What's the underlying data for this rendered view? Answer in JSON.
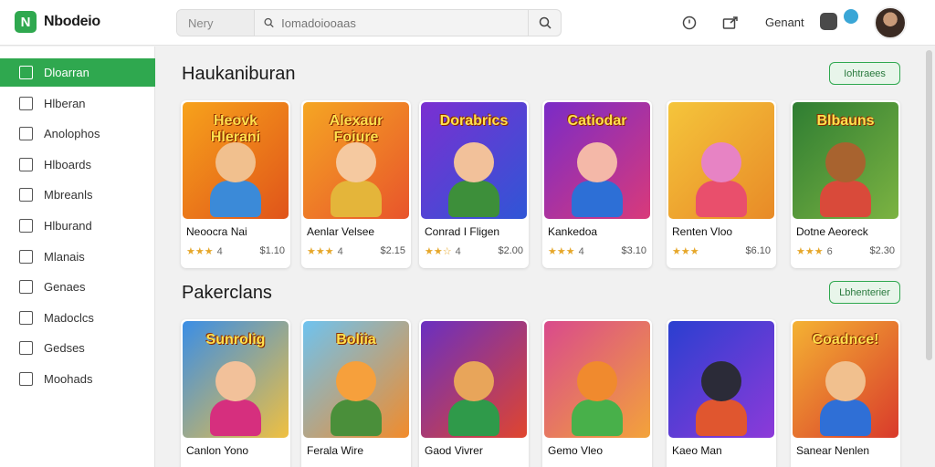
{
  "app": {
    "logo_letter": "N",
    "name": "Nbodeio"
  },
  "search": {
    "scope": "Nery",
    "placeholder": "Iomadoiooaas"
  },
  "topbar": {
    "label": "Genant"
  },
  "sidebar": {
    "items": [
      {
        "label": "Dloarran",
        "active": true
      },
      {
        "label": "Hlberan"
      },
      {
        "label": "Anolophos"
      },
      {
        "label": "Hlboards"
      },
      {
        "label": "Mbreanls"
      },
      {
        "label": "Hlburand"
      },
      {
        "label": "Mlanais"
      },
      {
        "label": "Genaes"
      },
      {
        "label": "Madoclcs"
      },
      {
        "label": "Gedses"
      },
      {
        "label": "Moohads"
      }
    ]
  },
  "sections": [
    {
      "title": "Haukaniburan",
      "action": "Iohtraees",
      "cards": [
        {
          "art_title": "Heovk Hlerani",
          "title": "Neoocra Nai",
          "stars": "★★★",
          "rating": "4",
          "price": "$1.10",
          "colors": [
            "#f7a21b",
            "#e0541a"
          ],
          "head": "#f1c08e",
          "body": "#3b8ad8"
        },
        {
          "art_title": "Alexaur Foiure",
          "title": "Aenlar Velsee",
          "stars": "★★★",
          "rating": "4",
          "price": "$2.15",
          "colors": [
            "#f5a623",
            "#e8542b"
          ],
          "head": "#f5c9a0",
          "body": "#e4b53a"
        },
        {
          "art_title": "Dorabrics",
          "title": "Conrad I Fligen",
          "stars": "★★☆",
          "rating": "4",
          "price": "$2.00",
          "colors": [
            "#7b2fd1",
            "#2f56d6"
          ],
          "head": "#f2c19a",
          "body": "#3d8f3a"
        },
        {
          "art_title": "Catiodar",
          "title": "Kankedoa",
          "stars": "★★★",
          "rating": "4",
          "price": "$3.10",
          "colors": [
            "#7a2bc7",
            "#d93a7a"
          ],
          "head": "#f4b8a8",
          "body": "#2d6fd6"
        },
        {
          "art_title": "",
          "title": "Renten Vloo",
          "stars": "★★★",
          "rating": "",
          "price": "$6.10",
          "colors": [
            "#f5c53b",
            "#e88a27"
          ],
          "head": "#e783c4",
          "body": "#e94f6c"
        },
        {
          "art_title": "Blbauns",
          "title": "Dotne Aeoreck",
          "stars": "★★★",
          "rating": "6",
          "price": "$2.30",
          "colors": [
            "#2e7d32",
            "#7cb342"
          ],
          "head": "#a8632f",
          "body": "#d94a3a"
        }
      ]
    },
    {
      "title": "Pakerclans",
      "action": "Lbhenterier",
      "cards": [
        {
          "art_title": "Sunrolig",
          "title": "Canlon Yono",
          "colors": [
            "#3a8ee6",
            "#f0c040"
          ],
          "head": "#f2c19a",
          "body": "#d62f7e"
        },
        {
          "art_title": "Boliia",
          "title": "Ferala Wire",
          "colors": [
            "#6ec3f0",
            "#f28b2a"
          ],
          "head": "#f6a03c",
          "body": "#4a8f3a"
        },
        {
          "art_title": "",
          "title": "Gaod Vivrer",
          "colors": [
            "#6a2fc1",
            "#e0452e"
          ],
          "head": "#e8a55a",
          "body": "#2f9a4a"
        },
        {
          "art_title": "",
          "title": "Gemo Vleo",
          "colors": [
            "#d94a8c",
            "#f3a33a"
          ],
          "head": "#f08a2e",
          "body": "#48b04a"
        },
        {
          "art_title": "",
          "title": "Kaeo Man",
          "colors": [
            "#2a3fd0",
            "#8d3ad9"
          ],
          "head": "#2b2b38",
          "body": "#e0562f"
        },
        {
          "art_title": "Coadnce!",
          "title": "Sanear Nenlen",
          "colors": [
            "#f4b233",
            "#d93a2b"
          ],
          "head": "#f1c08e",
          "body": "#2f6fd6"
        }
      ]
    }
  ]
}
